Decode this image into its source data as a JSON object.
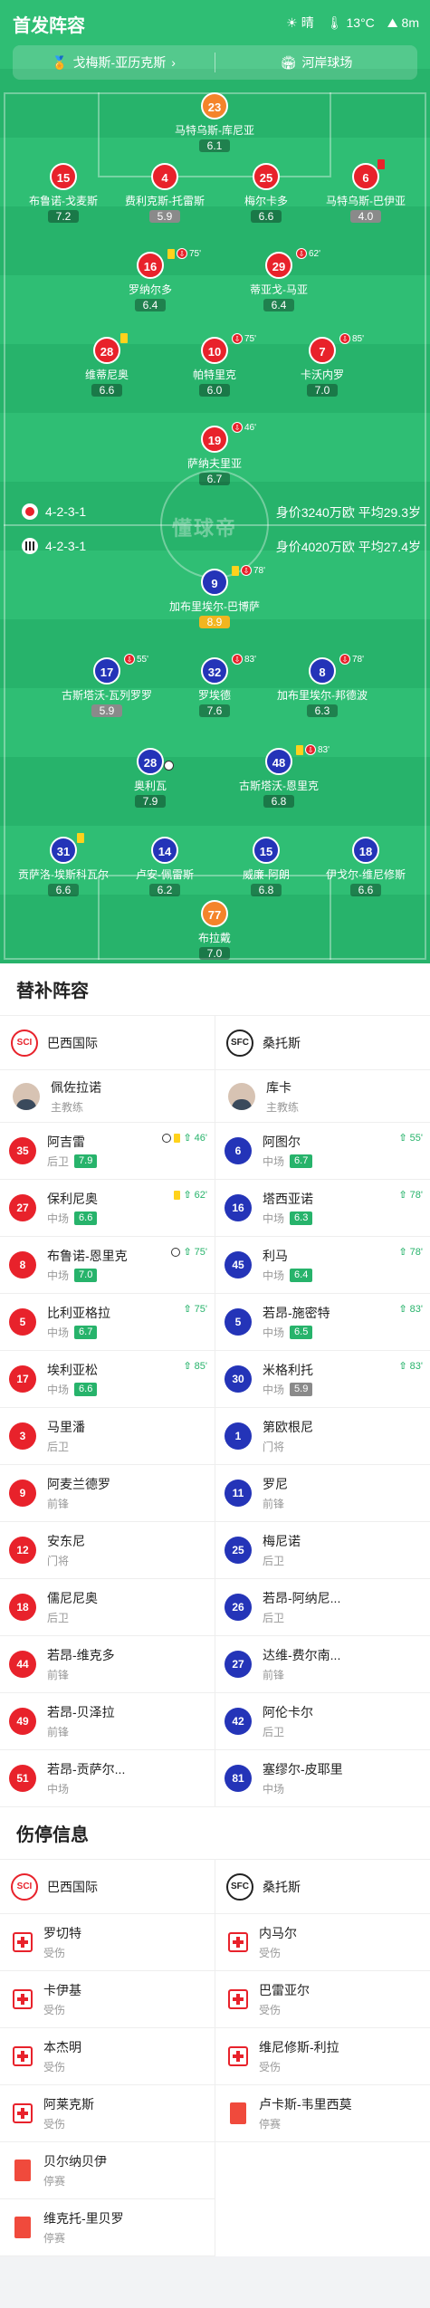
{
  "header": {
    "title": "首发阵容",
    "weather": "晴",
    "temperature": "13°C",
    "wind": "8m",
    "coach_link": "戈梅斯-亚历克斯",
    "stadium": "河岸球场"
  },
  "pitch": {
    "watermark": "懂球帝",
    "home": {
      "formation": "4-2-3-1",
      "value": "身价3240万欧 平均29.3岁",
      "players": [
        {
          "num": "23",
          "name": "马特乌斯-库尼亚",
          "rating": "6.1"
        },
        {
          "num": "15",
          "name": "布鲁诺-戈麦斯",
          "rating": "7.2"
        },
        {
          "num": "4",
          "name": "费利克斯-托雷斯",
          "rating": "5.9"
        },
        {
          "num": "25",
          "name": "梅尔卡多",
          "rating": "6.6"
        },
        {
          "num": "6",
          "name": "马特乌斯-巴伊亚",
          "rating": "4.0"
        },
        {
          "num": "16",
          "name": "罗纳尔多",
          "rating": "6.4",
          "ev": "75'"
        },
        {
          "num": "29",
          "name": "蒂亚戈-马亚",
          "rating": "6.4",
          "ev": "62'"
        },
        {
          "num": "28",
          "name": "维蒂尼奥",
          "rating": "6.6"
        },
        {
          "num": "10",
          "name": "帕特里克",
          "rating": "6.0",
          "ev": "75'"
        },
        {
          "num": "7",
          "name": "卡沃内罗",
          "rating": "7.0",
          "ev": "85'"
        },
        {
          "num": "19",
          "name": "萨纳夫里亚",
          "rating": "6.7",
          "ev": "46'"
        }
      ]
    },
    "away": {
      "formation": "4-2-3-1",
      "value": "身价4020万欧 平均27.4岁",
      "players": [
        {
          "num": "9",
          "name": "加布里埃尔-巴博萨",
          "rating": "8.9",
          "ev": "78'"
        },
        {
          "num": "17",
          "name": "古斯塔沃-瓦列罗罗",
          "rating": "5.9",
          "ev": "55'"
        },
        {
          "num": "32",
          "name": "罗埃德",
          "rating": "7.6",
          "ev": "83'"
        },
        {
          "num": "8",
          "name": "加布里埃尔-邦德波",
          "rating": "6.3",
          "ev": "78'"
        },
        {
          "num": "28",
          "name": "奥利瓦",
          "rating": "7.9"
        },
        {
          "num": "48",
          "name": "古斯塔沃-恩里克",
          "rating": "6.8",
          "ev": "83'"
        },
        {
          "num": "31",
          "name": "贡萨洛-埃斯科瓦尔",
          "rating": "6.6"
        },
        {
          "num": "14",
          "name": "卢安-佩雷斯",
          "rating": "6.2"
        },
        {
          "num": "15",
          "name": "威廉-阿朗",
          "rating": "6.8"
        },
        {
          "num": "18",
          "name": "伊戈尔-维尼修斯",
          "rating": "6.6"
        },
        {
          "num": "77",
          "name": "布拉戴",
          "rating": "7.0"
        }
      ]
    }
  },
  "subs": {
    "title": "替补阵容",
    "home_team": "巴西国际",
    "away_team": "桑托斯",
    "home_coach": {
      "name": "佩佐拉诺",
      "role": "主教练"
    },
    "away_coach": {
      "name": "库卡",
      "role": "主教练"
    },
    "home": [
      {
        "num": "35",
        "name": "阿吉雷",
        "pos": "后卫",
        "rating": "7.9",
        "ev": "46'"
      },
      {
        "num": "27",
        "name": "保利尼奥",
        "pos": "中场",
        "rating": "6.6",
        "ev": "62'"
      },
      {
        "num": "8",
        "name": "布鲁诺-恩里克",
        "pos": "中场",
        "rating": "7.0",
        "ev": "75'"
      },
      {
        "num": "5",
        "name": "比利亚格拉",
        "pos": "中场",
        "rating": "6.7",
        "ev": "75'"
      },
      {
        "num": "17",
        "name": "埃利亚松",
        "pos": "中场",
        "rating": "6.6",
        "ev": "85'"
      },
      {
        "num": "3",
        "name": "马里潘",
        "pos": "后卫"
      },
      {
        "num": "9",
        "name": "阿麦兰德罗",
        "pos": "前锋"
      },
      {
        "num": "12",
        "name": "安东尼",
        "pos": "门将"
      },
      {
        "num": "18",
        "name": "儒尼尼奥",
        "pos": "后卫"
      },
      {
        "num": "44",
        "name": "若昂-维克多",
        "pos": "前锋"
      },
      {
        "num": "49",
        "name": "若昂-贝泽拉",
        "pos": "前锋"
      },
      {
        "num": "51",
        "name": "若昂-贡萨尔...",
        "pos": "中场"
      }
    ],
    "away": [
      {
        "num": "6",
        "name": "阿图尔",
        "pos": "中场",
        "rating": "6.7",
        "ev": "55'"
      },
      {
        "num": "16",
        "name": "塔西亚诺",
        "pos": "中场",
        "rating": "6.3",
        "ev": "78'"
      },
      {
        "num": "45",
        "name": "利马",
        "pos": "中场",
        "rating": "6.4",
        "ev": "78'"
      },
      {
        "num": "5",
        "name": "若昂-施密特",
        "pos": "中场",
        "rating": "6.5",
        "ev": "83'"
      },
      {
        "num": "30",
        "name": "米格利托",
        "pos": "中场",
        "rating": "5.9",
        "ev": "83'"
      },
      {
        "num": "1",
        "name": "第欧根尼",
        "pos": "门将"
      },
      {
        "num": "11",
        "name": "罗尼",
        "pos": "前锋"
      },
      {
        "num": "25",
        "name": "梅尼诺",
        "pos": "后卫"
      },
      {
        "num": "26",
        "name": "若昂-阿纳尼...",
        "pos": "后卫"
      },
      {
        "num": "27",
        "name": "达维-费尔南...",
        "pos": "前锋"
      },
      {
        "num": "42",
        "name": "阿伦卡尔",
        "pos": "后卫"
      },
      {
        "num": "81",
        "name": "塞缪尔-皮耶里",
        "pos": "中场"
      }
    ]
  },
  "injuries": {
    "title": "伤停信息",
    "home_team": "巴西国际",
    "away_team": "桑托斯",
    "home": [
      {
        "name": "罗切特",
        "status": "受伤",
        "type": "injury"
      },
      {
        "name": "卡伊基",
        "status": "受伤",
        "type": "injury"
      },
      {
        "name": "本杰明",
        "status": "受伤",
        "type": "injury"
      },
      {
        "name": "阿莱克斯",
        "status": "受伤",
        "type": "injury"
      },
      {
        "name": "贝尔纳贝伊",
        "status": "停赛",
        "type": "suspension"
      },
      {
        "name": "维克托-里贝罗",
        "status": "停赛",
        "type": "suspension"
      }
    ],
    "away": [
      {
        "name": "内马尔",
        "status": "受伤",
        "type": "injury"
      },
      {
        "name": "巴雷亚尔",
        "status": "受伤",
        "type": "injury"
      },
      {
        "name": "维尼修斯-利拉",
        "status": "受伤",
        "type": "injury"
      },
      {
        "name": "卢卡斯-韦里西莫",
        "status": "停赛",
        "type": "suspension"
      }
    ]
  },
  "colors": {
    "pitch": "#27b36b",
    "home": "#e8222b",
    "away": "#2434b8",
    "keeper": "#f4842b",
    "rating_best": "#f2b51f"
  }
}
